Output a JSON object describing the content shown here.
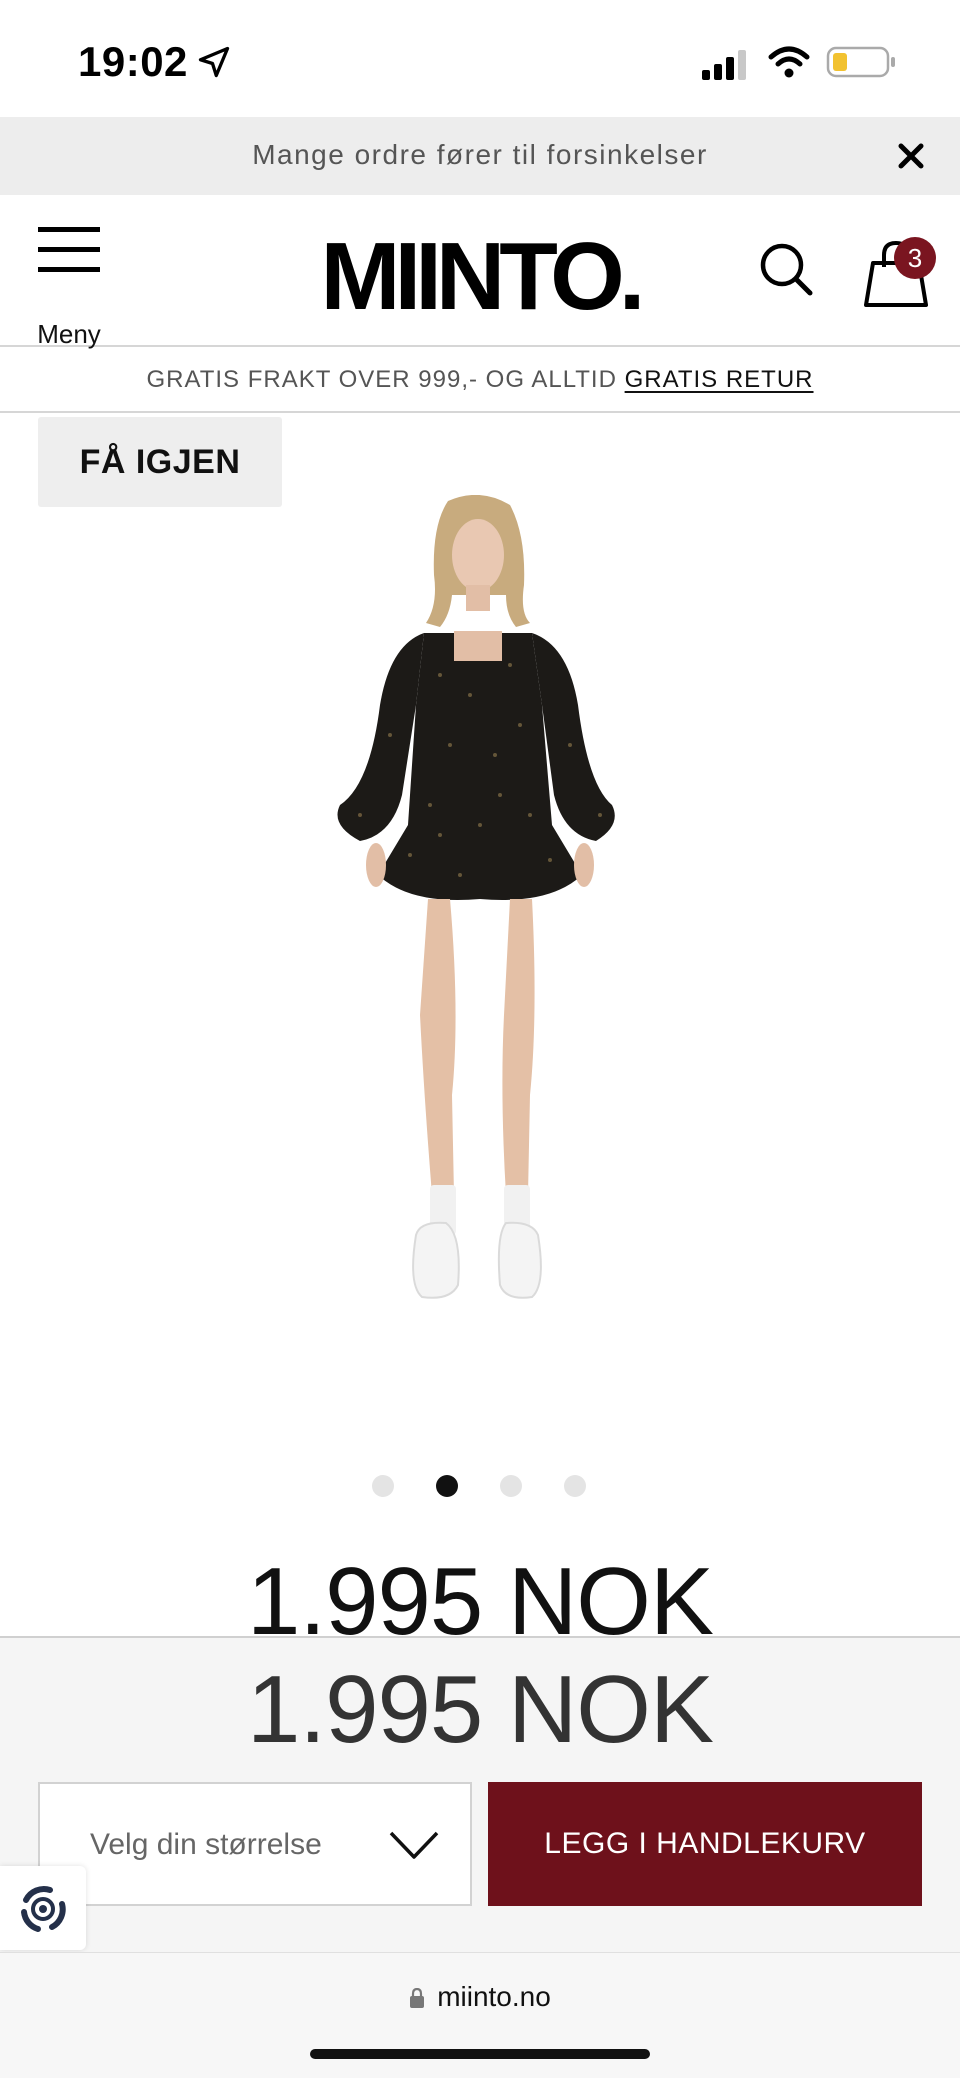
{
  "status_bar": {
    "time": "19:02"
  },
  "announcement": {
    "text": "Mange ordre fører til forsinkelser"
  },
  "header": {
    "menu_label": "Meny",
    "logo_text": "MIINTO.",
    "cart_count": "3"
  },
  "shipping": {
    "text": "GRATIS FRAKT OVER 999,- OG ALLTID ",
    "link": "GRATIS RETUR"
  },
  "product": {
    "tag": "FÅ IGJEN",
    "price": "1.995 NOK",
    "gallery": {
      "count": 4,
      "active_index": 1
    },
    "image_icon": "product-model-photo"
  },
  "buy_bar": {
    "price": "1.995 NOK",
    "size_placeholder": "Velg din størrelse",
    "add_to_cart": "LEGG I HANDLEKURV"
  },
  "browser": {
    "url": "miinto.no"
  },
  "colors": {
    "accent": "#6e111b",
    "badge": "#7a1520",
    "announce_bg": "#ededed"
  }
}
